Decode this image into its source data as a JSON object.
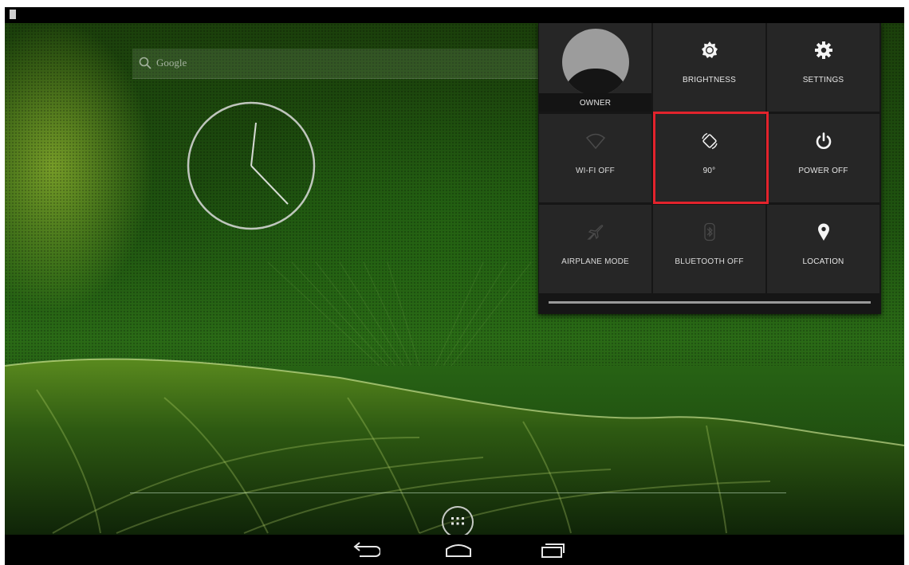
{
  "search": {
    "label": "Google"
  },
  "quick_settings": {
    "tiles": [
      {
        "label": "OWNER",
        "icon": "user-avatar-icon",
        "state": "on"
      },
      {
        "label": "BRIGHTNESS",
        "icon": "brightness-icon",
        "state": "on"
      },
      {
        "label": "SETTINGS",
        "icon": "settings-gear-icon",
        "state": "on"
      },
      {
        "label": "WI-FI OFF",
        "icon": "wifi-icon",
        "state": "off"
      },
      {
        "label": "90°",
        "icon": "screen-rotation-icon",
        "state": "on"
      },
      {
        "label": "POWER OFF",
        "icon": "power-icon",
        "state": "on"
      },
      {
        "label": "AIRPLANE MODE",
        "icon": "airplane-icon",
        "state": "off"
      },
      {
        "label": "BLUETOOTH OFF",
        "icon": "bluetooth-icon",
        "state": "off"
      },
      {
        "label": "LOCATION",
        "icon": "location-pin-icon",
        "state": "on"
      }
    ]
  },
  "nav_bar": {
    "buttons": [
      "back-icon",
      "home-icon",
      "recent-apps-icon"
    ]
  },
  "colors": {
    "highlight": "#e3232c",
    "panel": "#161616",
    "tile": "#262626"
  }
}
